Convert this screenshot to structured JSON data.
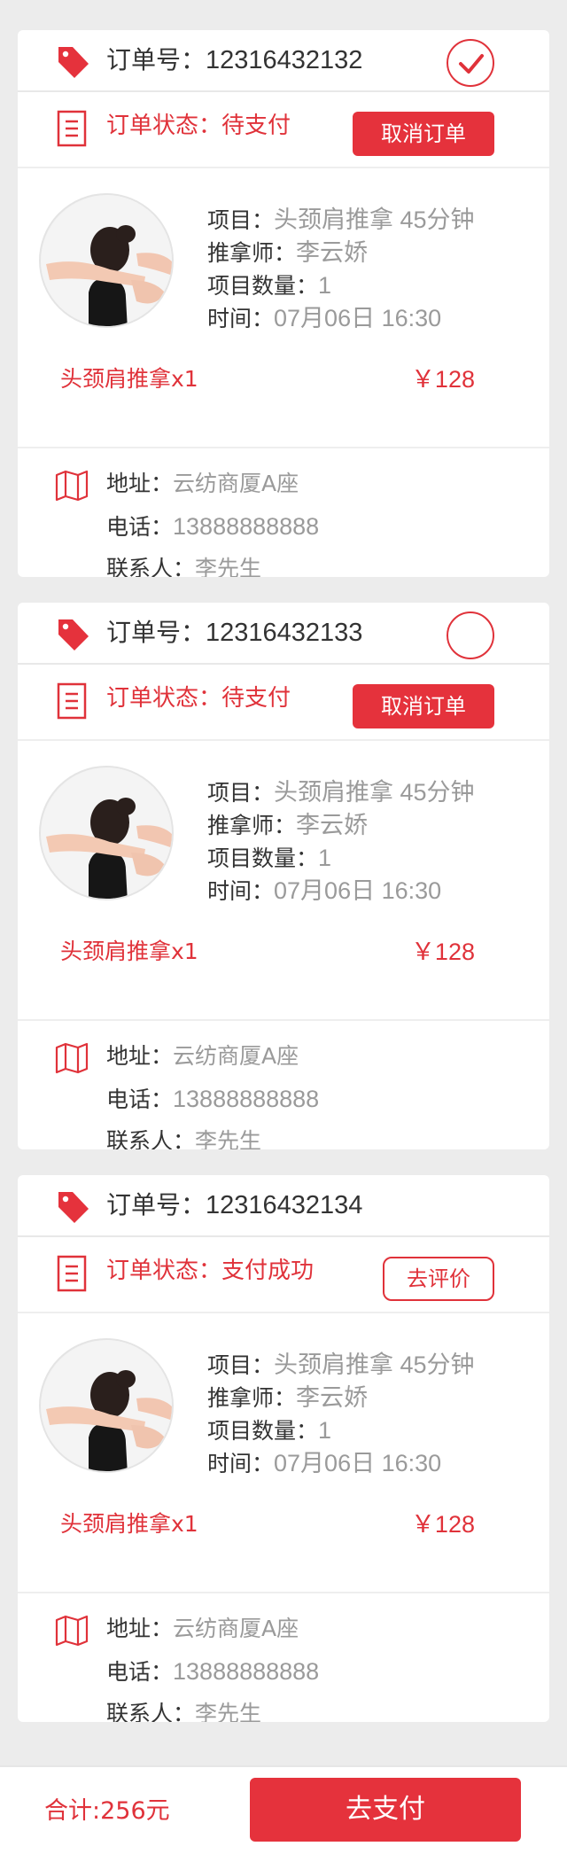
{
  "orders": [
    {
      "order_label": "订单号：",
      "order_no": "12316432132",
      "selected": true,
      "status_label": "订单状态：",
      "status_value": "待支付",
      "action_label": "取消订单",
      "action_type": "cancel",
      "project_label": "项目：",
      "project_value": "头颈肩推拿  45分钟",
      "therapist_label": "推拿师：",
      "therapist_value": "李云娇",
      "quantity_label": "项目数量：",
      "quantity_value": "1",
      "time_label": "时间：",
      "time_value": "07月06日  16:30",
      "summary_name": "头颈肩推拿x1",
      "summary_price": "￥128",
      "address_label": "地址：",
      "address_value": "云纺商厦A座",
      "phone_label": "电话：",
      "phone_value": "13888888888",
      "contact_label": "联系人：",
      "contact_value": "李先生"
    },
    {
      "order_label": "订单号：",
      "order_no": "12316432133",
      "selected": false,
      "status_label": "订单状态：",
      "status_value": "待支付",
      "action_label": "取消订单",
      "action_type": "cancel",
      "project_label": "项目：",
      "project_value": "头颈肩推拿  45分钟",
      "therapist_label": "推拿师：",
      "therapist_value": "李云娇",
      "quantity_label": "项目数量：",
      "quantity_value": "1",
      "time_label": "时间：",
      "time_value": "07月06日  16:30",
      "summary_name": "头颈肩推拿x1",
      "summary_price": "￥128",
      "address_label": "地址：",
      "address_value": "云纺商厦A座",
      "phone_label": "电话：",
      "phone_value": "13888888888",
      "contact_label": "联系人：",
      "contact_value": "李先生"
    },
    {
      "order_label": "订单号：",
      "order_no": "12316432134",
      "selected": null,
      "status_label": "订单状态：",
      "status_value": "支付成功",
      "action_label": "去评价",
      "action_type": "review",
      "project_label": "项目：",
      "project_value": "头颈肩推拿  45分钟",
      "therapist_label": "推拿师：",
      "therapist_value": "李云娇",
      "quantity_label": "项目数量：",
      "quantity_value": "1",
      "time_label": "时间：",
      "time_value": "07月06日  16:30",
      "summary_name": "头颈肩推拿x1",
      "summary_price": "￥128",
      "address_label": "地址：",
      "address_value": "云纺商厦A座",
      "phone_label": "电话：",
      "phone_value": "13888888888",
      "contact_label": "联系人：",
      "contact_value": "李先生"
    }
  ],
  "footer": {
    "total_label": "合计:256元",
    "pay_label": "去支付"
  },
  "colors": {
    "accent": "#e5323c",
    "background": "#ececec",
    "muted_text": "#9a9a9a"
  },
  "icons": {
    "order_tag": "tag-icon",
    "status": "document-icon",
    "address": "map-icon",
    "selected": "checkmark-icon"
  }
}
